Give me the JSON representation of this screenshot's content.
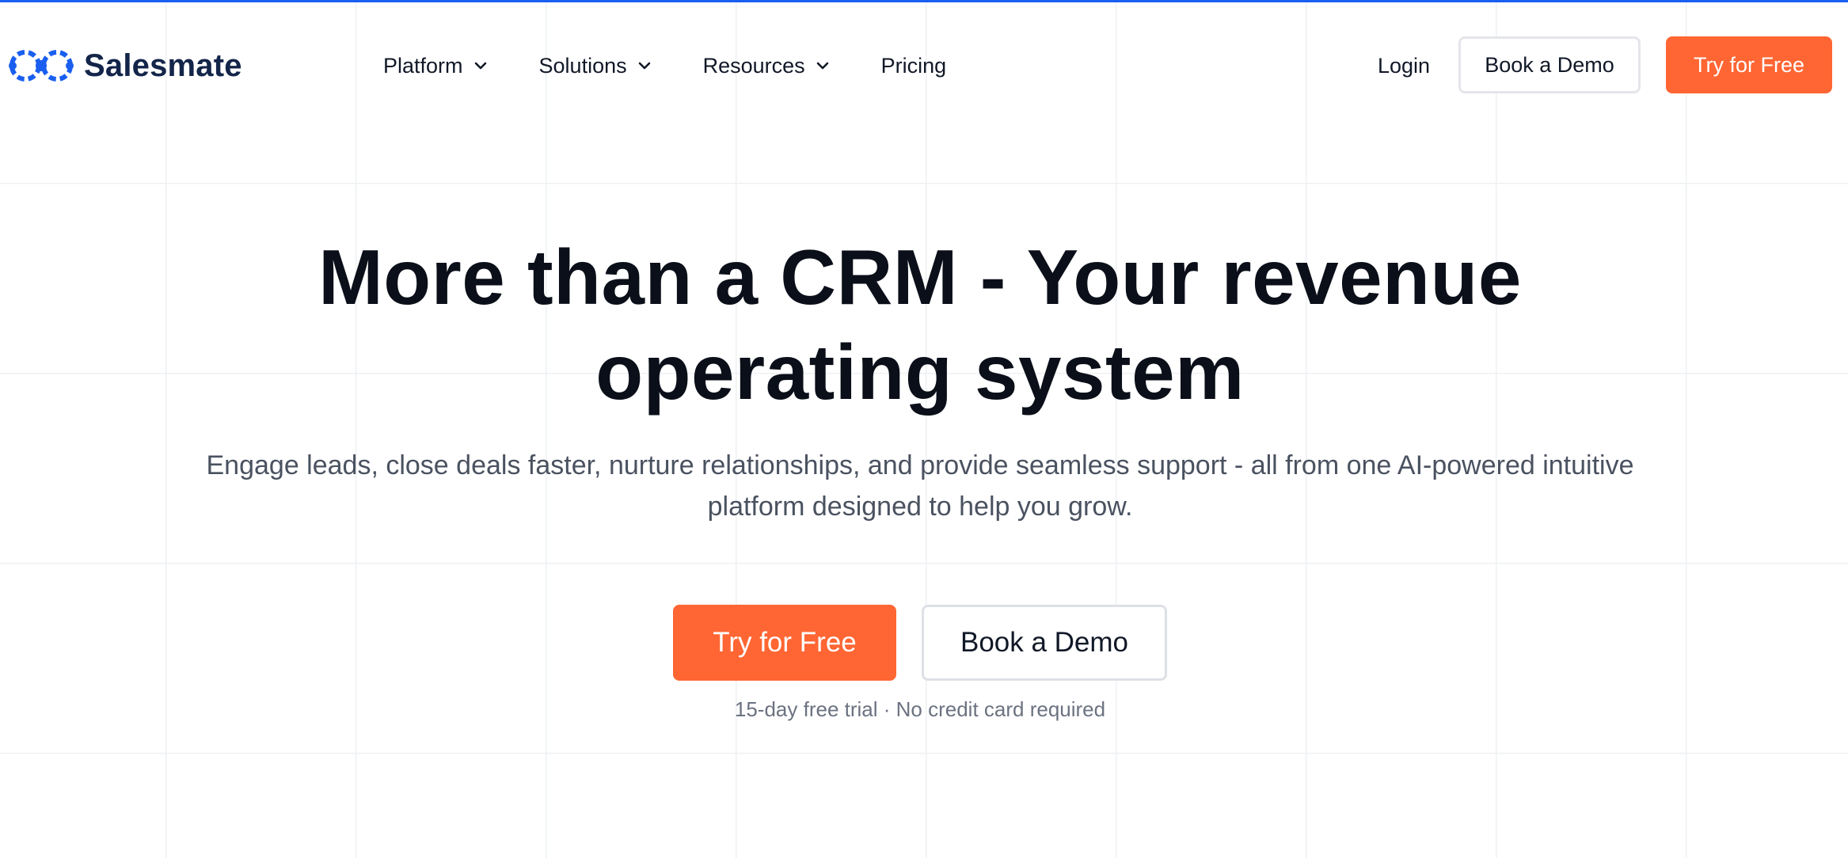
{
  "brand": {
    "name": "Salesmate",
    "logo_icon": "salesmate-logo-icon",
    "accent_color": "#1a5ff0",
    "cta_color": "#ff6633"
  },
  "nav": {
    "items": [
      {
        "label": "Platform",
        "has_dropdown": true
      },
      {
        "label": "Solutions",
        "has_dropdown": true
      },
      {
        "label": "Resources",
        "has_dropdown": true
      },
      {
        "label": "Pricing",
        "has_dropdown": false
      }
    ],
    "login_label": "Login",
    "book_demo_label": "Book a Demo",
    "try_free_label": "Try for Free"
  },
  "hero": {
    "title_line1": "More than a CRM - Your revenue",
    "title_line2": "operating system",
    "subtitle_line1": "Engage leads, close deals faster, nurture relationships, and provide seamless support - all from one AI-powered intuitive",
    "subtitle_line2": "platform designed to help you grow.",
    "primary_cta": "Try for Free",
    "secondary_cta": "Book a Demo",
    "note": "15-day free trial · No credit card required"
  }
}
